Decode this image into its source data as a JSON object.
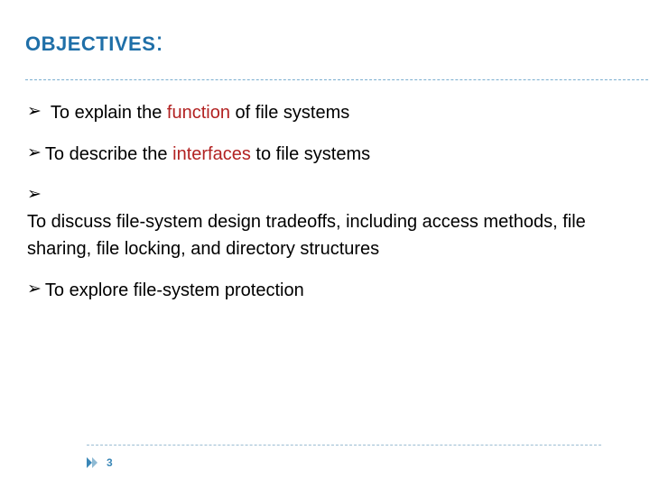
{
  "title": "OBJECTIVES",
  "title_colon": ":",
  "bullets": [
    {
      "pre": "To explain the ",
      "hl": "function",
      "post": " of file systems",
      "pad": true
    },
    {
      "pre": "To describe the ",
      "hl": "interfaces",
      "post": " to file systems",
      "pad": false
    },
    {
      "pre": "To discuss file-system design tradeoffs, including access methods, file sharing, file locking, and directory structures",
      "hl": "",
      "post": "",
      "pad": false
    },
    {
      "pre": "To explore file-system protection",
      "hl": "",
      "post": "",
      "pad": false
    }
  ],
  "page_number": "3"
}
